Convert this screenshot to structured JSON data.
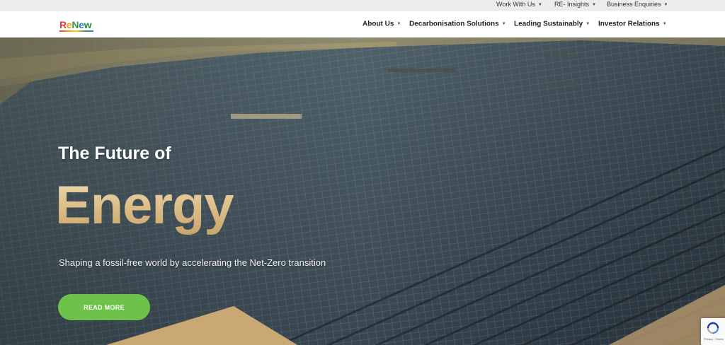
{
  "utility_nav": {
    "items": [
      {
        "label": "Work With Us"
      },
      {
        "label": "RE- Insights"
      },
      {
        "label": "Business Enquiries"
      }
    ]
  },
  "brand": {
    "logo_parts": [
      "R",
      "e",
      "N",
      "e",
      "w"
    ]
  },
  "main_nav": {
    "items": [
      {
        "label": "About Us"
      },
      {
        "label": "Decarbonisation Solutions"
      },
      {
        "label": "Leading Sustainably"
      },
      {
        "label": "Investor Relations"
      }
    ]
  },
  "hero": {
    "heading": "The Future of",
    "highlight": "Energy",
    "subtitle": "Shaping a fossil-free world by accelerating the Net-Zero transition",
    "cta_label": "READ MORE"
  },
  "recaptcha": {
    "text": "Privacy - Terms"
  },
  "colors": {
    "accent_green": "#6ec24a",
    "highlight_gold": "#e4cfa6",
    "panel_dark": "#3c4a55"
  }
}
